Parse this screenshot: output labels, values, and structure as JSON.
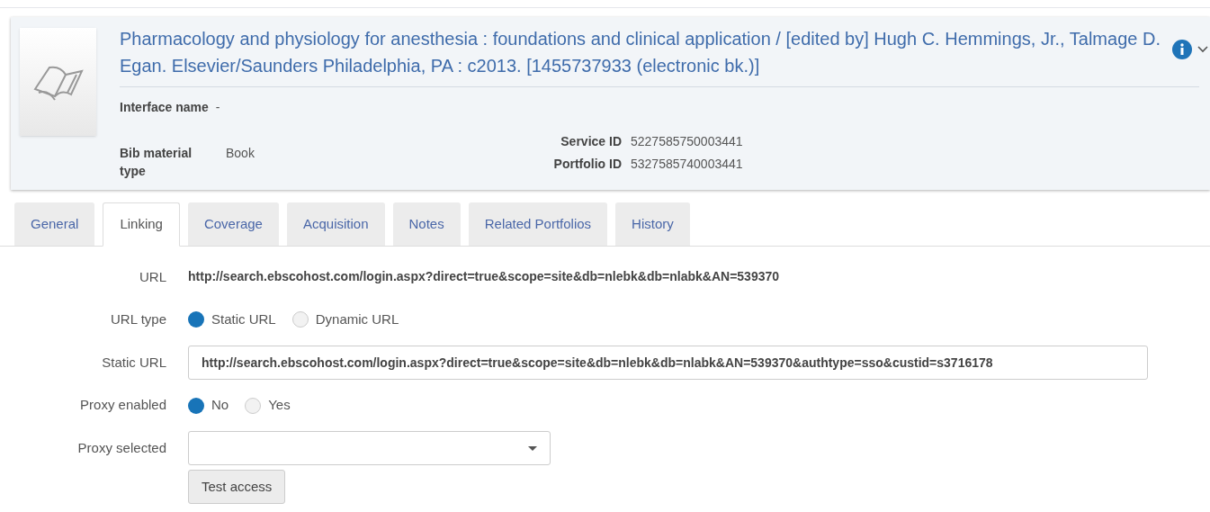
{
  "record": {
    "title": "Pharmacology and physiology for anesthesia : foundations and clinical application / [edited by] Hugh C. Hemmings, Jr., Talmage D. Egan. Elsevier/Saunders Philadelphia, PA : c2013. [1455737933 (electronic bk.)]",
    "fields_left": [
      {
        "label": "Interface name",
        "value": "-"
      },
      {
        "label": "Bib material type",
        "value": "Book"
      }
    ],
    "fields_right": [
      {
        "label": "Service ID",
        "value": "5227585750003441"
      },
      {
        "label": "Portfolio ID",
        "value": "5327585740003441"
      }
    ]
  },
  "tabs": [
    {
      "label": "General",
      "selected": false
    },
    {
      "label": "Linking",
      "selected": true
    },
    {
      "label": "Coverage",
      "selected": false
    },
    {
      "label": "Acquisition",
      "selected": false
    },
    {
      "label": "Notes",
      "selected": false
    },
    {
      "label": "Related Portfolios",
      "selected": false
    },
    {
      "label": "History",
      "selected": false
    }
  ],
  "form": [
    {
      "kind": "text",
      "label": "URL",
      "value": "http://search.ebscohost.com/login.aspx?direct=true&scope=site&db=nlebk&db=nlabk&AN=539370"
    },
    {
      "kind": "radio",
      "label": "URL type",
      "options": [
        {
          "label": "Static URL",
          "selected": true
        },
        {
          "label": "Dynamic URL",
          "selected": false
        }
      ]
    },
    {
      "kind": "input",
      "label": "Static URL",
      "value": "http://search.ebscohost.com/login.aspx?direct=true&scope=site&db=nlebk&db=nlabk&AN=539370&authtype=sso&custid=s3716178"
    },
    {
      "kind": "radio",
      "label": "Proxy enabled",
      "options": [
        {
          "label": "No",
          "selected": true
        },
        {
          "label": "Yes",
          "selected": false
        }
      ]
    },
    {
      "kind": "select",
      "label": "Proxy selected"
    },
    {
      "kind": "button",
      "label": "Test access"
    }
  ]
}
